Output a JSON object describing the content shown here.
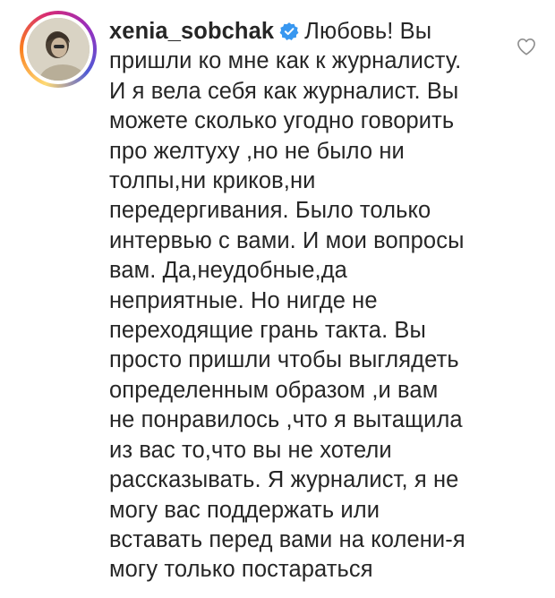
{
  "comment": {
    "username": "xenia_sobchak",
    "verified_icon": "verified-badge-icon",
    "like_icon": "heart-outline-icon",
    "lines": [
      "Любовь! Вы",
      "пришли ко мне как к журналисту.",
      "И я вела себя как журналист. Вы",
      "можете сколько угодно говорить",
      "про желтуху ,но не было ни",
      "толпы,ни криков,ни",
      "передергивания. Было только",
      "интервью с вами. И мои вопросы",
      "вам. Да,неудобные,да",
      "неприятные. Но нигде не",
      "переходящие грань такта. Вы",
      "просто пришли чтобы выглядеть",
      "определенным образом ,и вам",
      "не понравилось ,что я вытащила",
      "из вас то,что вы не хотели",
      "рассказывать. Я журналист, я не",
      "могу вас поддержать или",
      "вставать перед вами на колени-я",
      "могу только постараться"
    ]
  },
  "colors": {
    "text": "#262626",
    "verified": "#3897f0",
    "icon_gray": "#8e8e8e"
  }
}
